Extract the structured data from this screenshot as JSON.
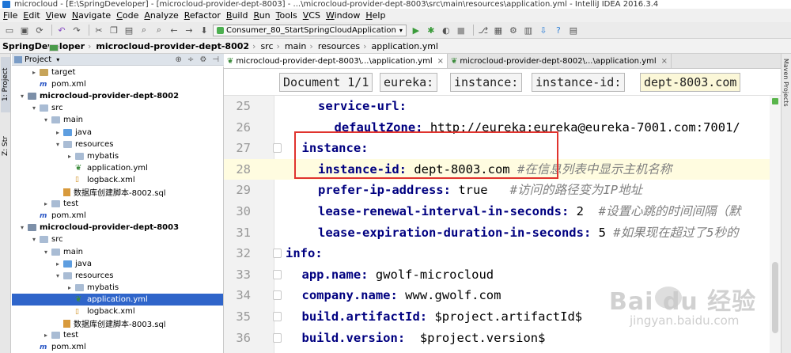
{
  "window": {
    "title": "microcloud - [E:\\SpringDeveloper] - [microcloud-provider-dept-8003] - ...\\microcloud-provider-dept-8003\\src\\main\\resources\\application.yml - IntelliJ IDEA 2016.3.4"
  },
  "menu": [
    "File",
    "Edit",
    "View",
    "Navigate",
    "Code",
    "Analyze",
    "Refactor",
    "Build",
    "Run",
    "Tools",
    "VCS",
    "Window",
    "Help"
  ],
  "toolbar": {
    "run_config": "Consumer_80_StartSpringCloudApplication"
  },
  "breadcrumbs": [
    "SpringDeveloper",
    "microcloud-provider-dept-8002",
    "src",
    "main",
    "resources",
    "application.yml"
  ],
  "project_panel": {
    "title": "Project",
    "side_tab": "1: Project",
    "side_tab2": "Z: Str"
  },
  "tree": [
    {
      "label": "target",
      "indent": 1,
      "arrow": "▸",
      "icon": "folderm"
    },
    {
      "label": "pom.xml",
      "indent": 1,
      "arrow": "",
      "icon": "pom"
    },
    {
      "label": "microcloud-provider-dept-8002",
      "indent": 0,
      "arrow": "▾",
      "icon": "mod",
      "bold": true
    },
    {
      "label": "src",
      "indent": 1,
      "arrow": "▾",
      "icon": "folder"
    },
    {
      "label": "main",
      "indent": 2,
      "arrow": "▾",
      "icon": "folder"
    },
    {
      "label": "java",
      "indent": 3,
      "arrow": "▸",
      "icon": "folderb"
    },
    {
      "label": "resources",
      "indent": 3,
      "arrow": "▾",
      "icon": "folder"
    },
    {
      "label": "mybatis",
      "indent": 4,
      "arrow": "▸",
      "icon": "folder"
    },
    {
      "label": "application.yml",
      "indent": 4,
      "arrow": "",
      "icon": "yml"
    },
    {
      "label": "logback.xml",
      "indent": 4,
      "arrow": "",
      "icon": "xml"
    },
    {
      "label": "数据库创建脚本-8002.sql",
      "indent": 3,
      "arrow": "",
      "icon": "sql"
    },
    {
      "label": "test",
      "indent": 2,
      "arrow": "▸",
      "icon": "folder"
    },
    {
      "label": "pom.xml",
      "indent": 1,
      "arrow": "",
      "icon": "pom"
    },
    {
      "label": "microcloud-provider-dept-8003",
      "indent": 0,
      "arrow": "▾",
      "icon": "mod",
      "bold": true
    },
    {
      "label": "src",
      "indent": 1,
      "arrow": "▾",
      "icon": "folder"
    },
    {
      "label": "main",
      "indent": 2,
      "arrow": "▾",
      "icon": "folder"
    },
    {
      "label": "java",
      "indent": 3,
      "arrow": "▸",
      "icon": "folderb"
    },
    {
      "label": "resources",
      "indent": 3,
      "arrow": "▾",
      "icon": "folder"
    },
    {
      "label": "mybatis",
      "indent": 4,
      "arrow": "▸",
      "icon": "folder"
    },
    {
      "label": "application.yml",
      "indent": 4,
      "arrow": "",
      "icon": "yml",
      "selected": true
    },
    {
      "label": "logback.xml",
      "indent": 4,
      "arrow": "",
      "icon": "xml"
    },
    {
      "label": "数据库创建脚本-8003.sql",
      "indent": 3,
      "arrow": "",
      "icon": "sql"
    },
    {
      "label": "test",
      "indent": 2,
      "arrow": "▸",
      "icon": "folder"
    },
    {
      "label": "pom.xml",
      "indent": 1,
      "arrow": "",
      "icon": "pom"
    }
  ],
  "tabs": [
    {
      "label": "microcloud-provider-dept-8003\\...\\application.yml",
      "active": true
    },
    {
      "label": "microcloud-provider-dept-8002\\...\\application.yml",
      "active": false
    }
  ],
  "yaml_path": [
    "Document 1/1",
    "eureka:",
    "instance:",
    "instance-id:",
    "dept-8003.com"
  ],
  "code_lines": [
    {
      "n": "25",
      "indent": 2,
      "key": "service-url:",
      "val": "",
      "comment": ""
    },
    {
      "n": "26",
      "indent": 3,
      "key": "defaultZone:",
      "val": " http://eureka:eureka@eureka-7001.com:7001/",
      "comment": ""
    },
    {
      "n": "27",
      "indent": 1,
      "key": "instance:",
      "val": "",
      "comment": ""
    },
    {
      "n": "28",
      "indent": 2,
      "key": "instance-id:",
      "val": " dept-8003.com ",
      "comment": "#在信息列表中显示主机名称",
      "current": true
    },
    {
      "n": "29",
      "indent": 2,
      "key": "prefer-ip-address:",
      "val": " true   ",
      "comment": "#访问的路径变为IP地址"
    },
    {
      "n": "30",
      "indent": 2,
      "key": "lease-renewal-interval-in-seconds:",
      "val": " 2  ",
      "comment": "#设置心跳的时间间隔（默"
    },
    {
      "n": "31",
      "indent": 2,
      "key": "lease-expiration-duration-in-seconds:",
      "val": " 5 ",
      "comment": "#如果现在超过了5秒的"
    },
    {
      "n": "32",
      "indent": 0,
      "key": "info:",
      "val": "",
      "comment": ""
    },
    {
      "n": "33",
      "indent": 1,
      "key": "app.name:",
      "val": " gwolf-microcloud",
      "comment": ""
    },
    {
      "n": "34",
      "indent": 1,
      "key": "company.name:",
      "val": " www.gwolf.com",
      "comment": ""
    },
    {
      "n": "35",
      "indent": 1,
      "key": "build.artifactId:",
      "val": " $project.artifactId$",
      "comment": ""
    },
    {
      "n": "36",
      "indent": 1,
      "key": "build.version:",
      "val": "  $project.version$",
      "comment": ""
    }
  ],
  "right_panel": {
    "label": "Maven Projects"
  },
  "watermark": {
    "logo": "Bai du 经验",
    "url": "jingyan.baidu.com"
  },
  "colors": {
    "selection": "#2f65ca",
    "highlight_box": "#e0332e",
    "keyword": "#000080",
    "comment": "#808080"
  }
}
